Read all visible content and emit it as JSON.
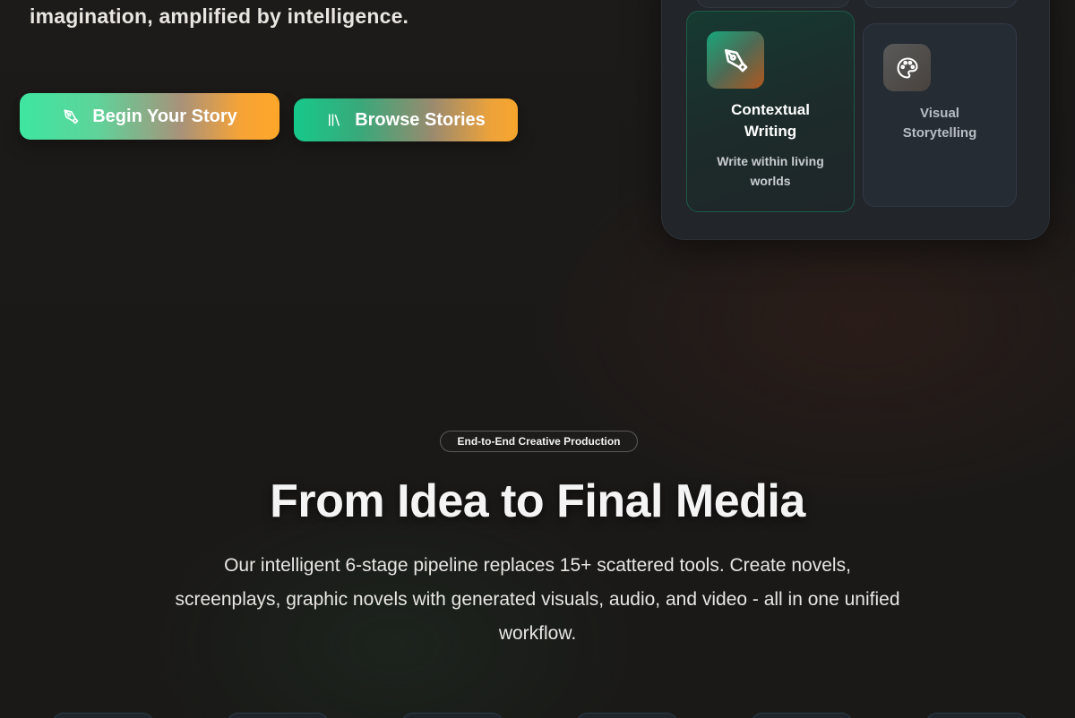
{
  "hero": {
    "tagline": "imagination, amplified by intelligence.",
    "primary_cta": {
      "label": "Begin Your Story",
      "icon": "pen-nib-icon"
    },
    "secondary_cta": {
      "label": "Browse Stories",
      "icon": "library-icon"
    }
  },
  "feature_panel": {
    "cards": [
      {
        "title": "Contextual\nWriting",
        "description": "Write within living\nworlds",
        "icon": "pen-nib-icon"
      },
      {
        "title": "Visual\nStorytelling",
        "description": "",
        "icon": "palette-icon"
      }
    ]
  },
  "pipeline_section": {
    "badge": "End-to-End Creative Production",
    "title": "From Idea to Final Media",
    "description": "Our intelligent 6-stage pipeline replaces 15+ scattered tools. Create novels, screenplays, graphic novels with generated visuals, audio, and video - all in one unified workflow.",
    "stage_count": 6
  },
  "colors": {
    "accent_green": "#3ee6a0",
    "accent_orange": "#ffa72a",
    "background": "#1c1a18"
  }
}
